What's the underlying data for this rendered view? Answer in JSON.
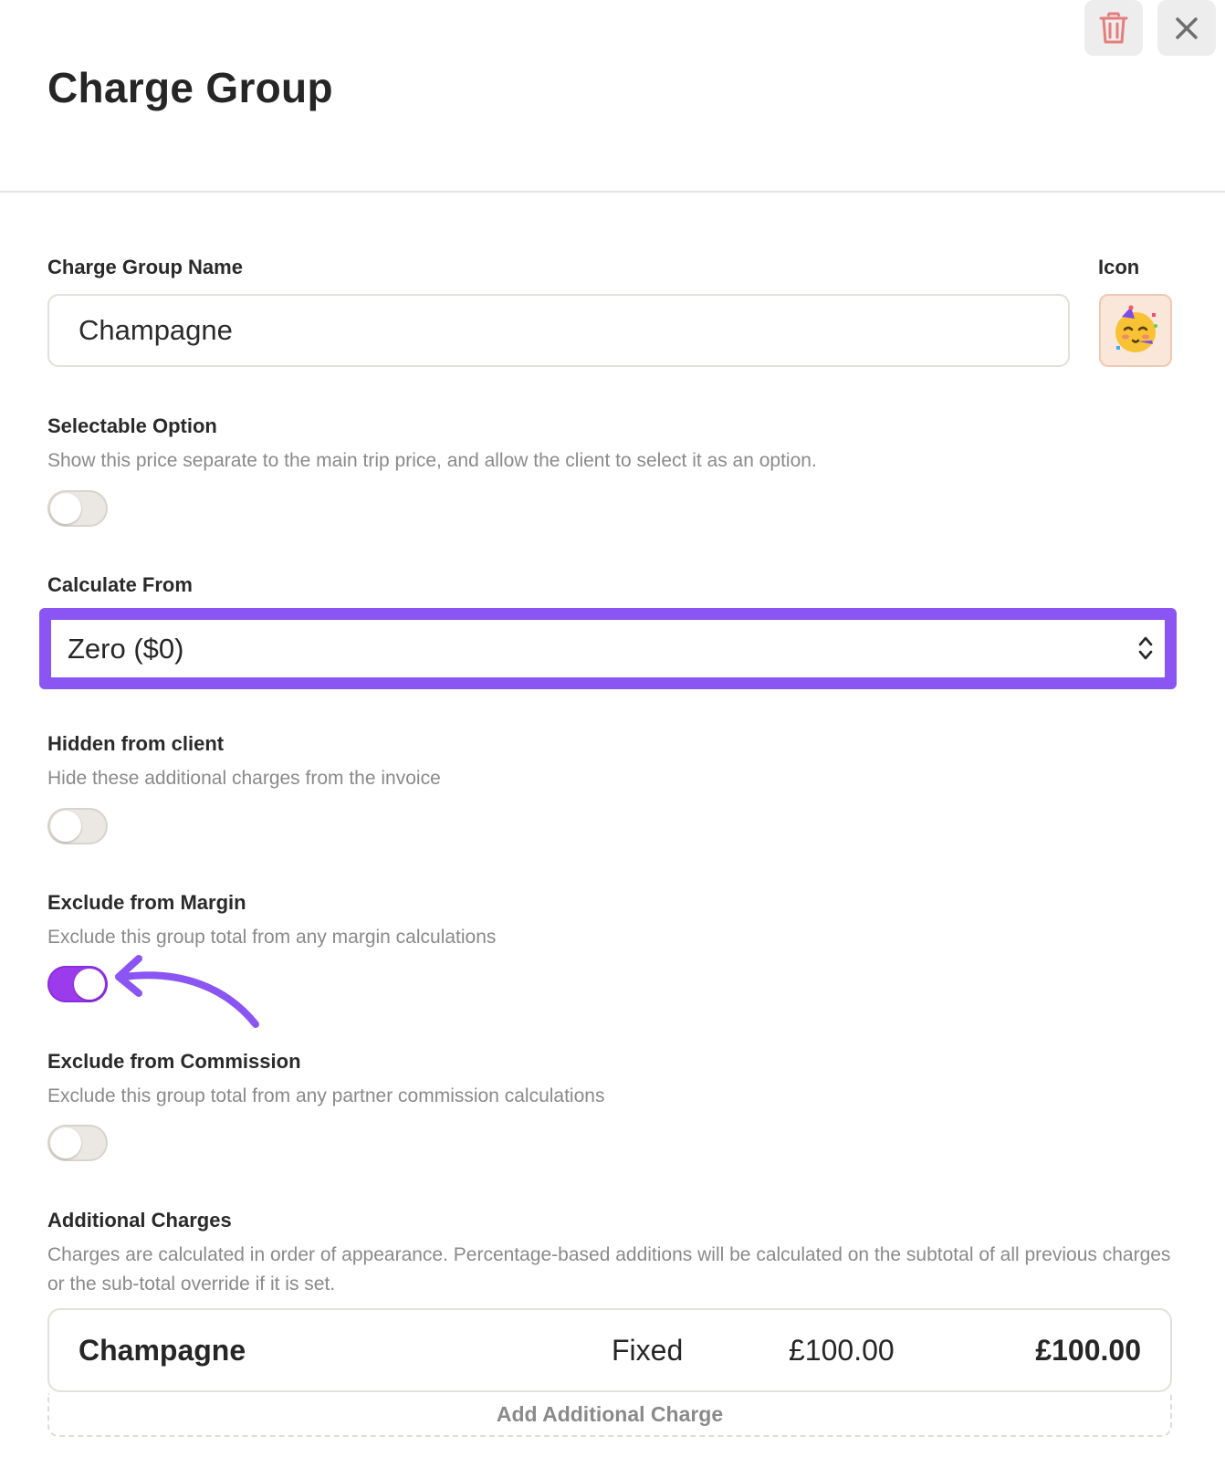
{
  "header": {
    "title": "Charge Group"
  },
  "toolbar": {
    "delete_icon": "trash-icon",
    "close_icon": "close-icon"
  },
  "form": {
    "name": {
      "label": "Charge Group Name",
      "value": "Champagne"
    },
    "icon": {
      "label": "Icon",
      "emoji": "partying-face",
      "name": "party-emoji-icon"
    },
    "selectable": {
      "label": "Selectable Option",
      "description": "Show this price separate to the main trip price, and allow the client to select it as an option.",
      "on": false
    },
    "calculate_from": {
      "label": "Calculate From",
      "value": "Zero ($0)"
    },
    "hidden": {
      "label": "Hidden from client",
      "description": "Hide these additional charges from the invoice",
      "on": false
    },
    "exclude_margin": {
      "label": "Exclude from Margin",
      "description": "Exclude this group total from any margin calculations",
      "on": true
    },
    "exclude_commission": {
      "label": "Exclude from Commission",
      "description": "Exclude this group total from any partner commission calculations",
      "on": false
    },
    "additional": {
      "label": "Additional Charges",
      "description": "Charges are calculated in order of appearance. Percentage-based additions will be calculated on the subtotal of all previous charges or the sub-total override if it is set.",
      "rows": [
        {
          "name": "Champagne",
          "type": "Fixed",
          "amount": "£100.00",
          "total": "£100.00"
        }
      ],
      "add_label": "Add Additional Charge"
    }
  },
  "colors": {
    "accent": "#8a55f2",
    "toggle_on": "#9b3bec",
    "delete_icon": "#e87c7c"
  }
}
